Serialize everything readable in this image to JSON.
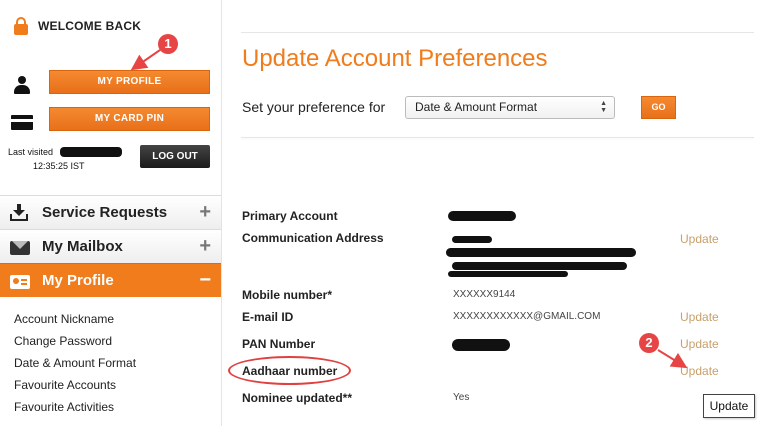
{
  "header": {
    "welcome": "WELCOME BACK"
  },
  "account": {
    "my_profile": "MY PROFILE",
    "my_card_pin": "MY CARD PIN",
    "last_visited_label": "Last visited",
    "last_visited_time": "12:35:25 IST",
    "logout": "LOG OUT"
  },
  "menu": [
    {
      "label": "Service Requests",
      "toggle": "+",
      "icon": "download-icon"
    },
    {
      "label": "My Mailbox",
      "toggle": "+",
      "icon": "mail-icon"
    },
    {
      "label": "My Profile",
      "toggle": "−",
      "icon": "profile-card-icon",
      "active": true
    }
  ],
  "submenu": [
    "Account Nickname",
    "Change Password",
    "Date & Amount Format",
    "Favourite Accounts",
    "Favourite Activities"
  ],
  "main": {
    "title": "Update Account Preferences",
    "pref_label": "Set your preference for",
    "pref_selected": "Date & Amount Format",
    "go": "GO"
  },
  "details": {
    "primary_account": "Primary Account",
    "communication_address": "Communication Address",
    "mobile_label": "Mobile number*",
    "mobile_value": "XXXXXX9144",
    "email_label": "E-mail ID",
    "email_value": "XXXXXXXXXXXX@GMAIL.COM",
    "pan_label": "PAN Number",
    "aadhaar_label": "Aadhaar number",
    "nominee_label": "Nominee updated**",
    "nominee_value": "Yes",
    "update": "Update"
  },
  "annotations": {
    "one": "1",
    "two": "2"
  },
  "tooltip": "Update",
  "colors": {
    "accent": "#f07c1c",
    "update_link": "#c8a06a",
    "annotation": "#e74545"
  }
}
